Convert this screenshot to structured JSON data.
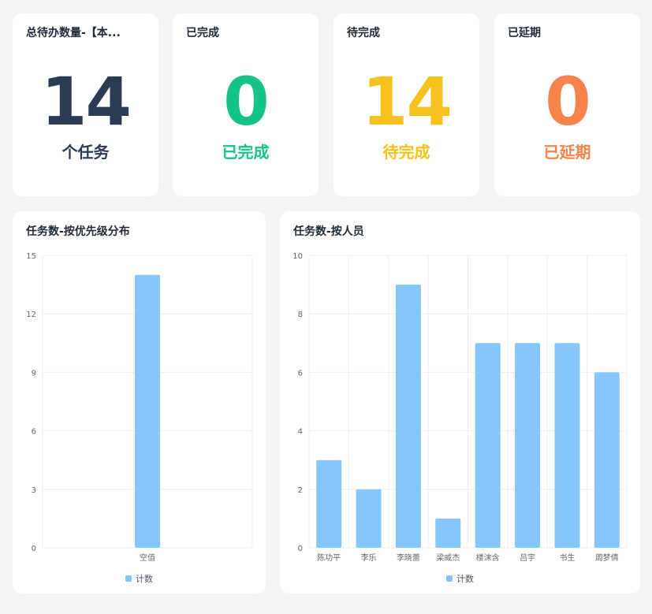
{
  "colors": {
    "navy": "#2b3a55",
    "green": "#14c28a",
    "yellow": "#f7c21e",
    "orange": "#f5834b",
    "bar": "#85c6fd",
    "grid": "#eeeeee",
    "axis_text": "#666666"
  },
  "stats": [
    {
      "title": "总待办数量-【本...",
      "value": "14",
      "label": "个任务"
    },
    {
      "title": "已完成",
      "value": "0",
      "label": "已完成"
    },
    {
      "title": "待完成",
      "value": "14",
      "label": "待完成"
    },
    {
      "title": "已延期",
      "value": "0",
      "label": "已延期"
    }
  ],
  "charts": {
    "priority": {
      "title": "任务数-按优先级分布",
      "legend": "计数"
    },
    "person": {
      "title": "任务数-按人员",
      "legend": "计数"
    }
  },
  "chart_data": [
    {
      "type": "bar",
      "title": "任务数-按优先级分布",
      "categories": [
        "空值"
      ],
      "series": [
        {
          "name": "计数",
          "values": [
            14
          ]
        }
      ],
      "ylim": [
        0,
        15
      ],
      "yticks": [
        0,
        3,
        6,
        9,
        12,
        15
      ],
      "grid": true,
      "legend": "bottom-center"
    },
    {
      "type": "bar",
      "title": "任务数-按人员",
      "categories": [
        "陈功平",
        "李乐",
        "李晓蕾",
        "梁威杰",
        "楼沫含",
        "吕宇",
        "书生",
        "周梦倩"
      ],
      "series": [
        {
          "name": "计数",
          "values": [
            3,
            2,
            9,
            1,
            7,
            7,
            7,
            6
          ]
        }
      ],
      "ylim": [
        0,
        10
      ],
      "yticks": [
        0,
        2,
        4,
        6,
        8,
        10
      ],
      "grid": true,
      "legend": "bottom-center"
    }
  ]
}
